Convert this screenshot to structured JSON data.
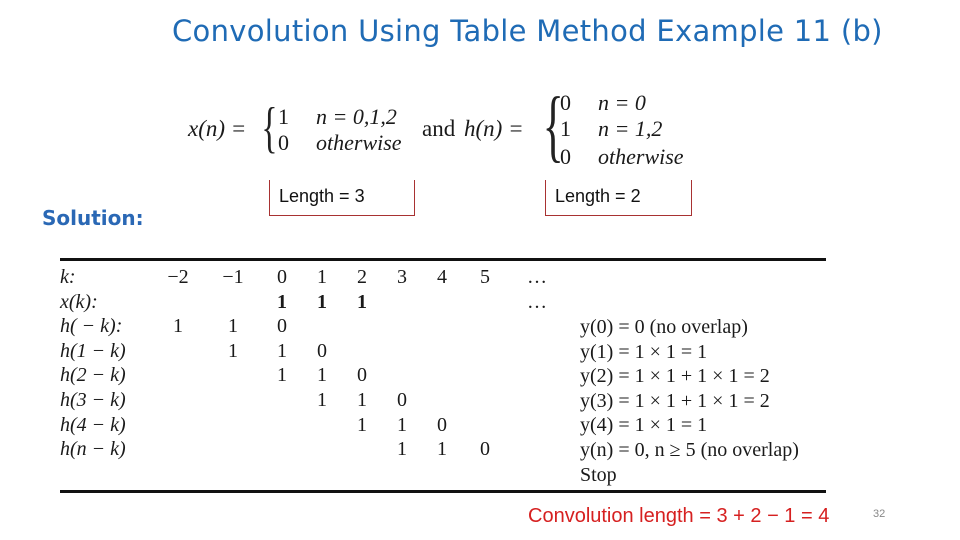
{
  "slide": {
    "title": "Convolution Using Table Method Example 11 (b)",
    "page_number": "32",
    "solution_label": "Solution:"
  },
  "definitions": {
    "x": {
      "lhs": "x(n) =",
      "cases": [
        {
          "value": "1",
          "condition": "n = 0,1,2"
        },
        {
          "value": "0",
          "condition": "otherwise"
        }
      ],
      "length_label": "Length = 3"
    },
    "connector": "and",
    "h": {
      "lhs": "h(n) =",
      "cases": [
        {
          "value": "0",
          "condition": "n = 0"
        },
        {
          "value": "1",
          "condition": "n = 1,2"
        },
        {
          "value": "0",
          "condition": "otherwise"
        }
      ],
      "length_label": "Length = 2"
    }
  },
  "table": {
    "k_label": "k:",
    "k_values": [
      "−2",
      "−1",
      "0",
      "1",
      "2",
      "3",
      "4",
      "5",
      "…"
    ],
    "rows": [
      {
        "label": "x(k):",
        "cells": [
          "",
          "",
          "1",
          "1",
          "1",
          "",
          "",
          "",
          "…"
        ],
        "bold": true
      },
      {
        "label": "h( − k):",
        "cells": [
          "1",
          "1",
          "0",
          "",
          "",
          "",
          "",
          "",
          ""
        ]
      },
      {
        "label": "h(1 − k)",
        "cells": [
          "",
          "1",
          "1",
          "0",
          "",
          "",
          "",
          "",
          ""
        ]
      },
      {
        "label": "h(2 − k)",
        "cells": [
          "",
          "",
          "1",
          "1",
          "0",
          "",
          "",
          "",
          ""
        ]
      },
      {
        "label": "h(3 − k)",
        "cells": [
          "",
          "",
          "",
          "1",
          "1",
          "0",
          "",
          "",
          ""
        ]
      },
      {
        "label": "h(4 − k)",
        "cells": [
          "",
          "",
          "",
          "",
          "1",
          "1",
          "0",
          "",
          ""
        ]
      },
      {
        "label": "h(n − k)",
        "cells": [
          "",
          "",
          "",
          "",
          "",
          "1",
          "1",
          "0",
          ""
        ]
      }
    ],
    "results": [
      "y(0) = 0 (no overlap)",
      "y(1) = 1 × 1 = 1",
      "y(2) = 1 × 1 + 1 × 1 = 2",
      "y(3) = 1 × 1 + 1 × 1 = 2",
      "y(4) = 1 × 1 = 1",
      "y(n) = 0, n ≥ 5 (no overlap)",
      "Stop"
    ]
  },
  "conclusion": "Convolution length = 3 + 2 − 1 = 4",
  "colors": {
    "title": "#1f6bb5",
    "solution": "#2a68b5",
    "conclusion": "#d62020",
    "length_box_border": "#a83232"
  }
}
